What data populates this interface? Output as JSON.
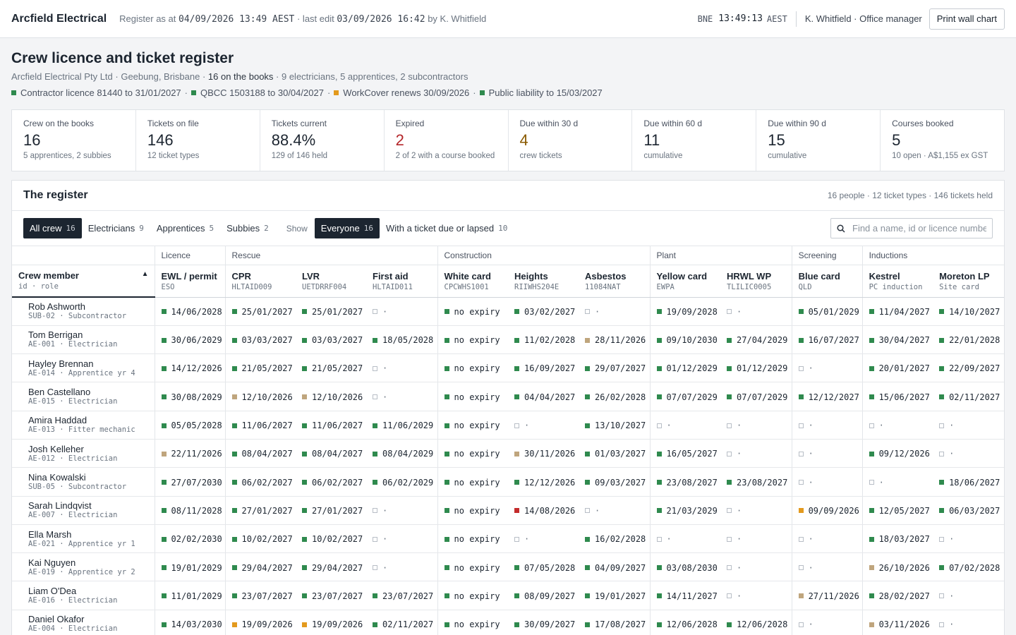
{
  "topbar": {
    "brand": "Arcfield Electrical",
    "status_prefix": "Register as at ",
    "as_at": "04/09/2026 13:49 AEST",
    "last_edit_prefix": " · last edit ",
    "last_edit": "03/09/2026 16:42",
    "last_edit_by": " by K. Whitfield",
    "clock_city": "BNE",
    "clock_time": "13:49:13",
    "clock_tz": "AEST",
    "user": "K. Whitfield · Office manager",
    "print_label": "Print wall chart"
  },
  "header": {
    "title": "Crew licence and ticket register",
    "company": "Arcfield Electrical Pty Ltd · Geebung, Brisbane · ",
    "on_books": "16 on the books",
    "breakdown": " · 9 electricians, 5 apprentices, 2 subcontractors",
    "compliance": [
      {
        "text": "Contractor licence 81440 to 31/01/2027",
        "status": "green"
      },
      {
        "text": "QBCC 1503188 to 30/04/2027",
        "status": "green"
      },
      {
        "text": "WorkCover renews 30/09/2026",
        "status": "amber"
      },
      {
        "text": "Public liability to 15/03/2027",
        "status": "green"
      }
    ]
  },
  "kpis": [
    {
      "label": "Crew on the books",
      "value": "16",
      "note": "5 apprentices, 2 subbies",
      "tone": ""
    },
    {
      "label": "Tickets on file",
      "value": "146",
      "note": "12 ticket types",
      "tone": ""
    },
    {
      "label": "Tickets current",
      "value": "88.4%",
      "note": "129 of 146 held",
      "tone": ""
    },
    {
      "label": "Expired",
      "value": "2",
      "note": "2 of 2 with a course booked",
      "tone": "red"
    },
    {
      "label": "Due within 30 d",
      "value": "4",
      "note": "crew tickets",
      "tone": "amber"
    },
    {
      "label": "Due within 60 d",
      "value": "11",
      "note": "cumulative",
      "tone": ""
    },
    {
      "label": "Due within 90 d",
      "value": "15",
      "note": "cumulative",
      "tone": ""
    },
    {
      "label": "Courses booked",
      "value": "5",
      "note": "10 open · A$1,155 ex GST",
      "tone": ""
    }
  ],
  "register": {
    "title": "The register",
    "meta": "16 people · 12 ticket types · 146 tickets held",
    "role_filters": [
      {
        "label": "All crew",
        "count": "16",
        "active": true
      },
      {
        "label": "Electricians",
        "count": "9",
        "active": false
      },
      {
        "label": "Apprentices",
        "count": "5",
        "active": false
      },
      {
        "label": "Subbies",
        "count": "2",
        "active": false
      }
    ],
    "show_label": "Show",
    "show_filters": [
      {
        "label": "Everyone",
        "count": "16",
        "active": true
      },
      {
        "label": "With a ticket due or lapsed",
        "count": "10",
        "active": false
      }
    ],
    "search_placeholder": "Find a name, id or licence number",
    "groups": [
      "",
      "Licence",
      "Rescue",
      "Construction",
      "Plant",
      "Screening",
      "Inductions"
    ],
    "crew_header": {
      "name": "Crew member",
      "sub": "id · role"
    },
    "columns": [
      {
        "name": "EWL / permit",
        "code": "ESO"
      },
      {
        "name": "CPR",
        "code": "HLTAID009"
      },
      {
        "name": "LVR",
        "code": "UETDRRF004"
      },
      {
        "name": "First aid",
        "code": "HLTAID011"
      },
      {
        "name": "White card",
        "code": "CPCWHS1001"
      },
      {
        "name": "Heights",
        "code": "RIIWHS204E"
      },
      {
        "name": "Asbestos",
        "code": "11084NAT"
      },
      {
        "name": "Yellow card",
        "code": "EWPA"
      },
      {
        "name": "HRWL WP",
        "code": "TLILIC0005"
      },
      {
        "name": "Blue card",
        "code": "QLD"
      },
      {
        "name": "Kestrel",
        "code": "PC induction"
      },
      {
        "name": "Moreton LP",
        "code": "Site card"
      }
    ],
    "rows": [
      {
        "name": "Rob Ashworth",
        "sub": "SUB-02 · Subcontractor",
        "cells": [
          [
            "ok",
            "14/06/2028"
          ],
          [
            "ok",
            "25/01/2027"
          ],
          [
            "ok",
            "25/01/2027"
          ],
          [
            "none",
            "·"
          ],
          [
            "ok",
            "no expiry"
          ],
          [
            "ok",
            "03/02/2027"
          ],
          [
            "none",
            "·"
          ],
          [
            "ok",
            "19/09/2028"
          ],
          [
            "none",
            "·"
          ],
          [
            "ok",
            "05/01/2029"
          ],
          [
            "ok",
            "11/04/2027"
          ],
          [
            "ok",
            "14/10/2027"
          ]
        ]
      },
      {
        "name": "Tom Berrigan",
        "sub": "AE-001 · Electrician",
        "cells": [
          [
            "ok",
            "30/06/2029"
          ],
          [
            "ok",
            "03/03/2027"
          ],
          [
            "ok",
            "03/03/2027"
          ],
          [
            "ok",
            "18/05/2028"
          ],
          [
            "ok",
            "no expiry"
          ],
          [
            "ok",
            "11/02/2028"
          ],
          [
            "due",
            "28/11/2026"
          ],
          [
            "ok",
            "09/10/2030"
          ],
          [
            "ok",
            "27/04/2029"
          ],
          [
            "ok",
            "16/07/2027"
          ],
          [
            "ok",
            "30/04/2027"
          ],
          [
            "ok",
            "22/01/2028"
          ]
        ]
      },
      {
        "name": "Hayley Brennan",
        "sub": "AE-014 · Apprentice yr 4",
        "cells": [
          [
            "ok",
            "14/12/2026"
          ],
          [
            "ok",
            "21/05/2027"
          ],
          [
            "ok",
            "21/05/2027"
          ],
          [
            "none",
            "·"
          ],
          [
            "ok",
            "no expiry"
          ],
          [
            "ok",
            "16/09/2027"
          ],
          [
            "ok",
            "29/07/2027"
          ],
          [
            "ok",
            "01/12/2029"
          ],
          [
            "ok",
            "01/12/2029"
          ],
          [
            "none",
            "·"
          ],
          [
            "ok",
            "20/01/2027"
          ],
          [
            "ok",
            "22/09/2027"
          ]
        ]
      },
      {
        "name": "Ben Castellano",
        "sub": "AE-015 · Electrician",
        "cells": [
          [
            "ok",
            "30/08/2029"
          ],
          [
            "due",
            "12/10/2026"
          ],
          [
            "due",
            "12/10/2026"
          ],
          [
            "none",
            "·"
          ],
          [
            "ok",
            "no expiry"
          ],
          [
            "ok",
            "04/04/2027"
          ],
          [
            "ok",
            "26/02/2028"
          ],
          [
            "ok",
            "07/07/2029"
          ],
          [
            "ok",
            "07/07/2029"
          ],
          [
            "ok",
            "12/12/2027"
          ],
          [
            "ok",
            "15/06/2027"
          ],
          [
            "ok",
            "02/11/2027"
          ]
        ]
      },
      {
        "name": "Amira Haddad",
        "sub": "AE-013 · Fitter mechanic",
        "cells": [
          [
            "ok",
            "05/05/2028"
          ],
          [
            "ok",
            "11/06/2027"
          ],
          [
            "ok",
            "11/06/2027"
          ],
          [
            "ok",
            "11/06/2029"
          ],
          [
            "ok",
            "no expiry"
          ],
          [
            "none",
            "·"
          ],
          [
            "ok",
            "13/10/2027"
          ],
          [
            "none",
            "·"
          ],
          [
            "none",
            "·"
          ],
          [
            "none",
            "·"
          ],
          [
            "none",
            "·"
          ],
          [
            "none",
            "·"
          ]
        ]
      },
      {
        "name": "Josh Kelleher",
        "sub": "AE-012 · Electrician",
        "cells": [
          [
            "due",
            "22/11/2026"
          ],
          [
            "ok",
            "08/04/2027"
          ],
          [
            "ok",
            "08/04/2027"
          ],
          [
            "ok",
            "08/04/2029"
          ],
          [
            "ok",
            "no expiry"
          ],
          [
            "due",
            "30/11/2026"
          ],
          [
            "ok",
            "01/03/2027"
          ],
          [
            "ok",
            "16/05/2027"
          ],
          [
            "none",
            "·"
          ],
          [
            "none",
            "·"
          ],
          [
            "ok",
            "09/12/2026"
          ],
          [
            "none",
            "·"
          ]
        ]
      },
      {
        "name": "Nina Kowalski",
        "sub": "SUB-05 · Subcontractor",
        "cells": [
          [
            "ok",
            "27/07/2030"
          ],
          [
            "ok",
            "06/02/2027"
          ],
          [
            "ok",
            "06/02/2027"
          ],
          [
            "ok",
            "06/02/2029"
          ],
          [
            "ok",
            "no expiry"
          ],
          [
            "ok",
            "12/12/2026"
          ],
          [
            "ok",
            "09/03/2027"
          ],
          [
            "ok",
            "23/08/2027"
          ],
          [
            "ok",
            "23/08/2027"
          ],
          [
            "none",
            "·"
          ],
          [
            "none",
            "·"
          ],
          [
            "ok",
            "18/06/2027"
          ]
        ]
      },
      {
        "name": "Sarah Lindqvist",
        "sub": "AE-007 · Electrician",
        "cells": [
          [
            "ok",
            "08/11/2028"
          ],
          [
            "ok",
            "27/01/2027"
          ],
          [
            "ok",
            "27/01/2027"
          ],
          [
            "none",
            "·"
          ],
          [
            "ok",
            "no expiry"
          ],
          [
            "expired",
            "14/08/2026"
          ],
          [
            "none",
            "·"
          ],
          [
            "ok",
            "21/03/2029"
          ],
          [
            "none",
            "·"
          ],
          [
            "lapsing",
            "09/09/2026"
          ],
          [
            "ok",
            "12/05/2027"
          ],
          [
            "ok",
            "06/03/2027"
          ]
        ]
      },
      {
        "name": "Ella Marsh",
        "sub": "AE-021 · Apprentice yr 1",
        "cells": [
          [
            "ok",
            "02/02/2030"
          ],
          [
            "ok",
            "10/02/2027"
          ],
          [
            "ok",
            "10/02/2027"
          ],
          [
            "none",
            "·"
          ],
          [
            "ok",
            "no expiry"
          ],
          [
            "none",
            "·"
          ],
          [
            "ok",
            "16/02/2028"
          ],
          [
            "none",
            "·"
          ],
          [
            "none",
            "·"
          ],
          [
            "none",
            "·"
          ],
          [
            "ok",
            "18/03/2027"
          ],
          [
            "none",
            "·"
          ]
        ]
      },
      {
        "name": "Kai Nguyen",
        "sub": "AE-019 · Apprentice yr 2",
        "cells": [
          [
            "ok",
            "19/01/2029"
          ],
          [
            "ok",
            "29/04/2027"
          ],
          [
            "ok",
            "29/04/2027"
          ],
          [
            "none",
            "·"
          ],
          [
            "ok",
            "no expiry"
          ],
          [
            "ok",
            "07/05/2028"
          ],
          [
            "ok",
            "04/09/2027"
          ],
          [
            "ok",
            "03/08/2030"
          ],
          [
            "none",
            "·"
          ],
          [
            "none",
            "·"
          ],
          [
            "due",
            "26/10/2026"
          ],
          [
            "ok",
            "07/02/2028"
          ]
        ]
      },
      {
        "name": "Liam O'Dea",
        "sub": "AE-016 · Electrician",
        "cells": [
          [
            "ok",
            "11/01/2029"
          ],
          [
            "ok",
            "23/07/2027"
          ],
          [
            "ok",
            "23/07/2027"
          ],
          [
            "ok",
            "23/07/2027"
          ],
          [
            "ok",
            "no expiry"
          ],
          [
            "ok",
            "08/09/2027"
          ],
          [
            "ok",
            "19/01/2027"
          ],
          [
            "ok",
            "14/11/2027"
          ],
          [
            "none",
            "·"
          ],
          [
            "due",
            "27/11/2026"
          ],
          [
            "ok",
            "28/02/2027"
          ],
          [
            "none",
            "·"
          ]
        ]
      },
      {
        "name": "Daniel Okafor",
        "sub": "AE-004 · Electrician",
        "cells": [
          [
            "ok",
            "14/03/2030"
          ],
          [
            "lapsing",
            "19/09/2026"
          ],
          [
            "lapsing",
            "19/09/2026"
          ],
          [
            "ok",
            "02/11/2027"
          ],
          [
            "ok",
            "no expiry"
          ],
          [
            "ok",
            "30/09/2027"
          ],
          [
            "ok",
            "17/08/2027"
          ],
          [
            "ok",
            "12/06/2028"
          ],
          [
            "ok",
            "12/06/2028"
          ],
          [
            "none",
            "·"
          ],
          [
            "due",
            "03/11/2026"
          ],
          [
            "none",
            "·"
          ]
        ]
      }
    ]
  }
}
